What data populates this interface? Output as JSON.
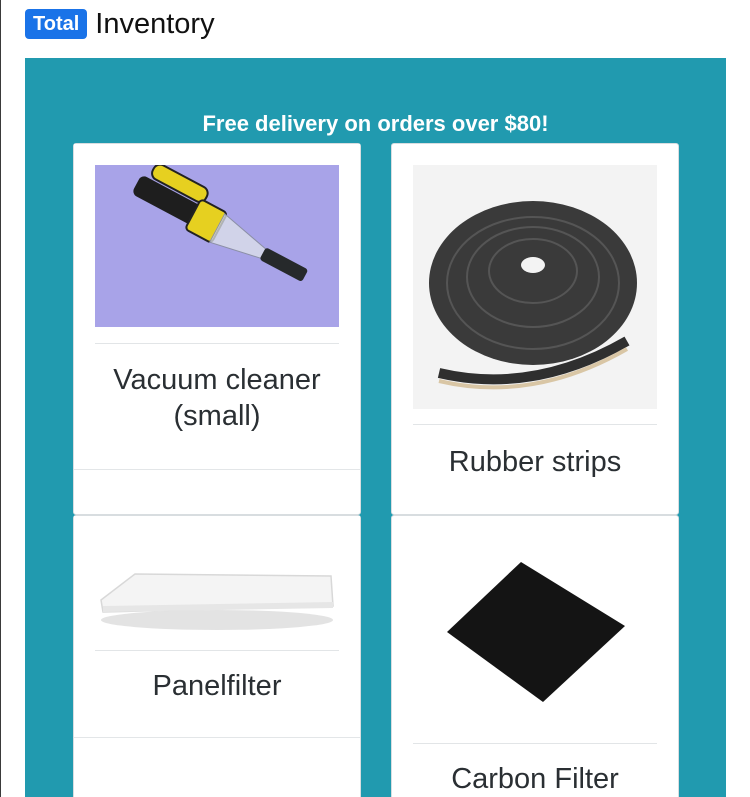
{
  "header": {
    "badge": "Total",
    "title": "Inventory"
  },
  "panel": {
    "promo": "Free delivery on orders over $80!"
  },
  "products": [
    {
      "name": "Vacuum cleaner (small)"
    },
    {
      "name": "Rubber strips"
    },
    {
      "name": "Panelfilter"
    },
    {
      "name": "Carbon Filter"
    }
  ],
  "colors": {
    "badge": "#1a73e8",
    "panel": "#219aaf",
    "card": "#ffffff",
    "text": "#2a2f33"
  }
}
